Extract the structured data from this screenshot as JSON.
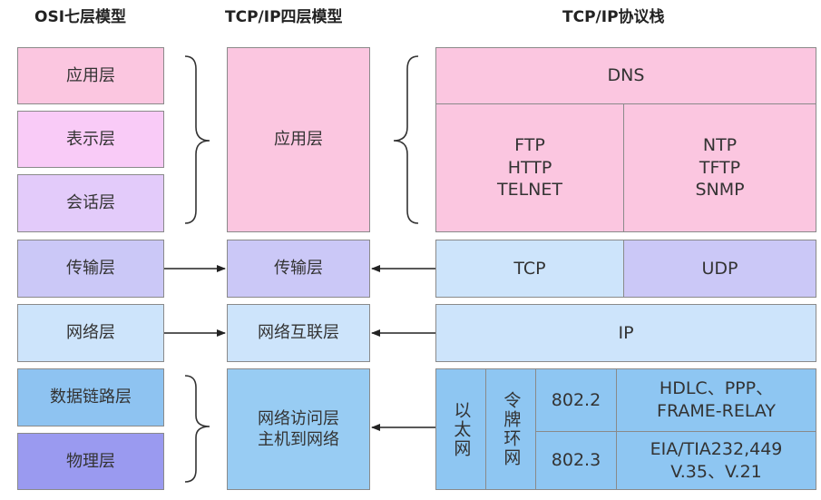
{
  "headers": {
    "osi": "OSI七层模型",
    "tcpip4": "TCP/IP四层模型",
    "stack": "TCP/IP协议栈"
  },
  "osi_layers": [
    "应用层",
    "表示层",
    "会话层",
    "传输层",
    "网络层",
    "数据链路层",
    "物理层"
  ],
  "tcpip_layers": {
    "application": "应用层",
    "transport": "传输层",
    "internet": "网络互联层",
    "link_line1": "网络访问层",
    "link_line2": "主机到网络"
  },
  "protocols": {
    "dns": "DNS",
    "tcp_app": [
      "FTP",
      "HTTP",
      "TELNET"
    ],
    "udp_app": [
      "NTP",
      "TFTP",
      "SNMP"
    ],
    "tcp": "TCP",
    "udp": "UDP",
    "ip": "IP",
    "ethernet": "以太网",
    "token_ring": "令牌环网",
    "ieee_8022": "802.2",
    "ieee_8023": "802.3",
    "hdlc_line1": "HDLC、PPP、",
    "hdlc_line2": "FRAME-RELAY",
    "eia_line1": "EIA/TIA232,449",
    "eia_line2": "V.35、V.21"
  },
  "colors": {
    "application": "#fbc6e0",
    "presentation": "#f9cbf7",
    "session": "#e3cbfa",
    "transport": "#cbc8f7",
    "network": "#cde4fb",
    "datalink": "#8ec3f1",
    "physical": "#9a9af0",
    "link_access": "#98ccf3",
    "link_protocols": "#8ec6f2"
  }
}
